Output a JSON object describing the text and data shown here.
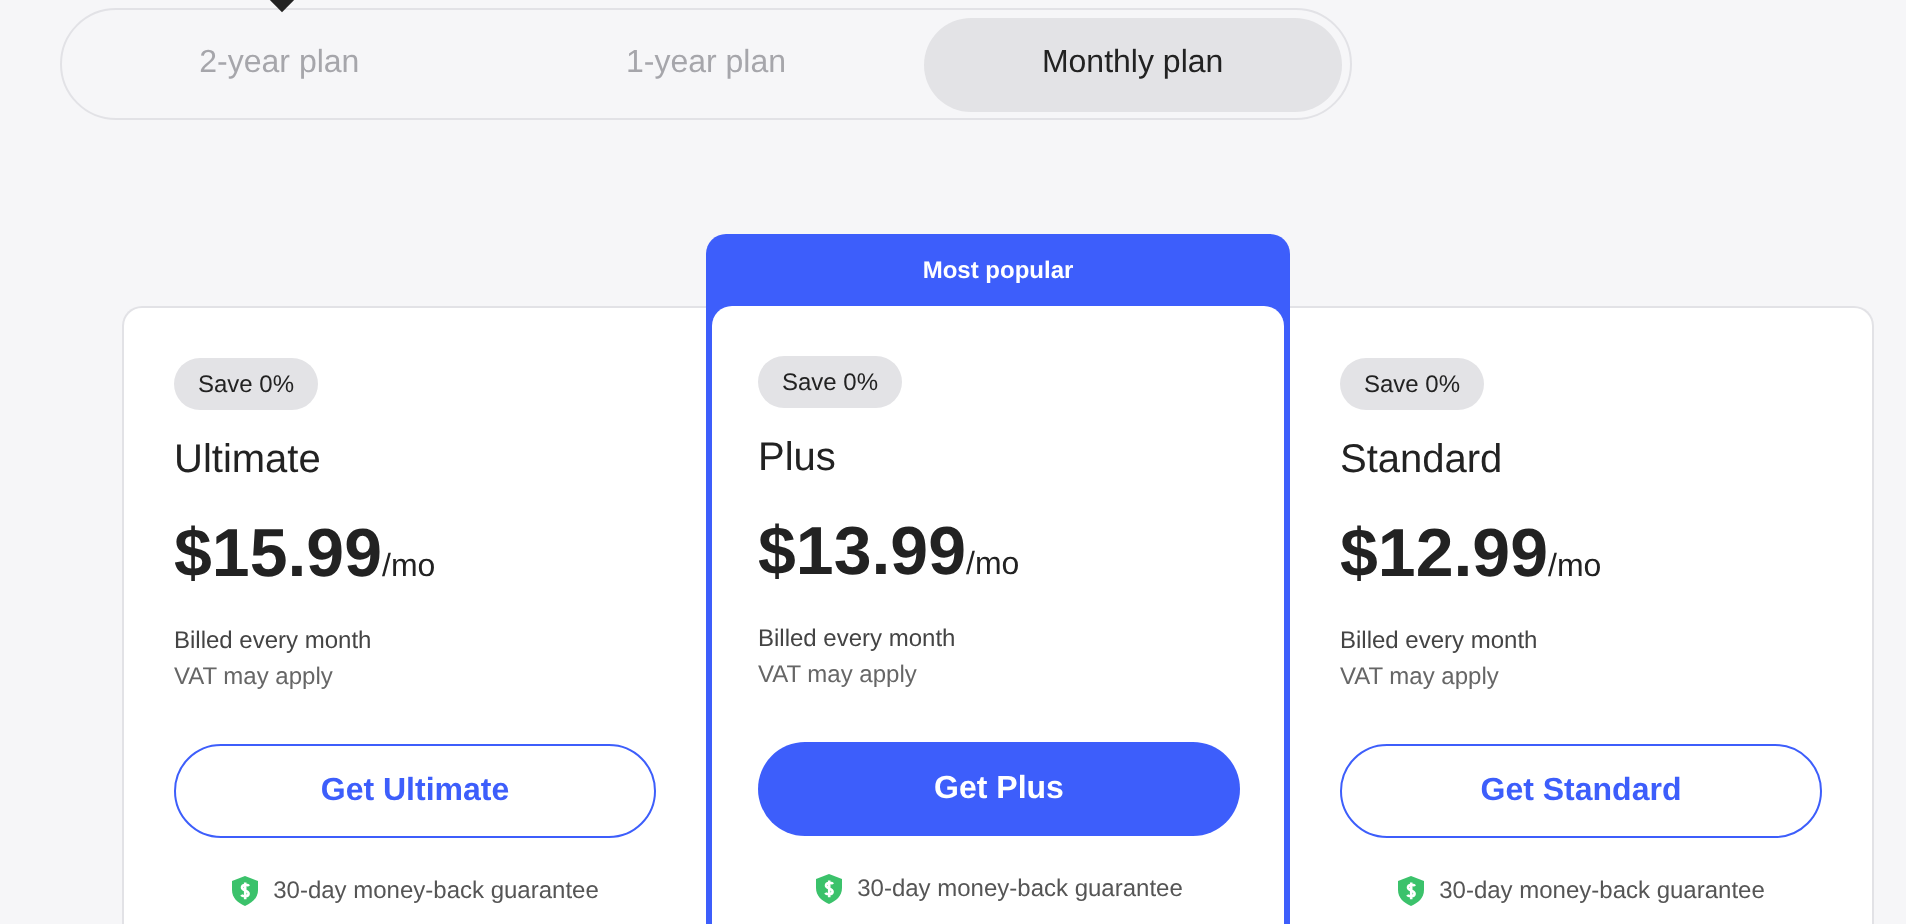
{
  "tabs": [
    {
      "label": "2-year plan",
      "selected": false
    },
    {
      "label": "1-year plan",
      "selected": false
    },
    {
      "label": "Monthly plan",
      "selected": true
    }
  ],
  "plans": [
    {
      "featured": false,
      "badge": "Save 0%",
      "name": "Ultimate",
      "price": "$15.99",
      "period": "/mo",
      "billing": "Billed every month",
      "tax": "VAT may apply",
      "button": "Get Ultimate",
      "guarantee": "30-day money-back guarantee"
    },
    {
      "featured": true,
      "ribbon": "Most popular",
      "badge": "Save 0%",
      "name": "Plus",
      "price": "$13.99",
      "period": "/mo",
      "billing": "Billed every month",
      "tax": "VAT may apply",
      "button": "Get Plus",
      "guarantee": "30-day money-back guarantee"
    },
    {
      "featured": false,
      "badge": "Save 0%",
      "name": "Standard",
      "price": "$12.99",
      "period": "/mo",
      "billing": "Billed every month",
      "tax": "VAT may apply",
      "button": "Get Standard",
      "guarantee": "30-day money-back guarantee"
    }
  ]
}
